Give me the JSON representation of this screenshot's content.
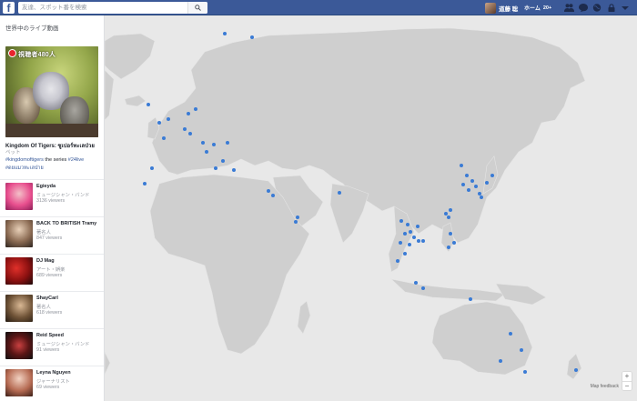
{
  "topbar": {
    "logo": "f",
    "search_placeholder": "友達、スポット番を検索",
    "profile_name": "道藤 聡",
    "home_label": "ホーム",
    "home_count": "20+"
  },
  "sidebar": {
    "title": "世界中のライブ動画",
    "featured": {
      "viewers_overlay": "視聴者480人",
      "title": "Kingdom Of Tigers: ซูเปอร์ทะเลป่วย",
      "category": "ペット",
      "tags_text": " the series ",
      "tag1": "#kingdomoftigers",
      "tag2": "#24live",
      "tag3": "#ดยแมวทะเลป่าย"
    },
    "items": [
      {
        "name": "Egieyda",
        "category": "ミュージシャン・バンド",
        "viewers": "3136 viewers"
      },
      {
        "name": "BACK TO BRITISH Tramy",
        "category": "著名人",
        "viewers": "847 viewers"
      },
      {
        "name": "DJ Mag",
        "category": "アート・娯楽",
        "viewers": "689 viewers"
      },
      {
        "name": "ShayCarl",
        "category": "著名人",
        "viewers": "618 viewers"
      },
      {
        "name": "Reid Speed",
        "category": "ミュージシャン・バンド",
        "viewers": "91 viewers"
      },
      {
        "name": "Leyna Nguyen",
        "category": "ジャーナリスト",
        "viewers": "69 viewers"
      }
    ]
  },
  "map": {
    "feedback_label": "Map feedback",
    "zoom_in": "+",
    "zoom_out": "−",
    "land_color": "#cfcfcf",
    "water_color": "#e8e8e8",
    "dot_color": "#3a7bd5"
  }
}
